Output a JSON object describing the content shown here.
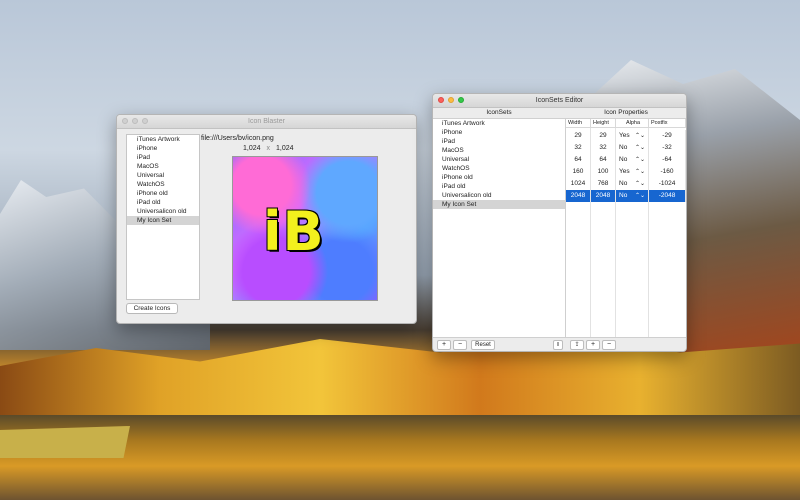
{
  "icon_blaster": {
    "title": "Icon Blaster",
    "list": [
      "iTunes Artwork",
      "iPhone",
      "iPad",
      "MacOS",
      "Universal",
      "WatchOS",
      "iPhone old",
      "iPad old",
      "Universalicon old",
      "My Icon Set"
    ],
    "selected_index": 9,
    "file_path": "file:///Users/bv/icon.png",
    "width": "1,024",
    "times": "x",
    "height": "1,024",
    "preview_text": "iB",
    "create_button": "Create Icons"
  },
  "iconsets_editor": {
    "title": "IconSets Editor",
    "left_header": "IconSets",
    "right_header": "Icon Properties",
    "sets": [
      "iTunes Artwork",
      "iPhone",
      "iPad",
      "MacOS",
      "Universal",
      "WatchOS",
      "iPhone old",
      "iPad old",
      "Universalicon old",
      "My Icon Set"
    ],
    "selected_set_index": 9,
    "columns": [
      "Width",
      "Height",
      "Alpha",
      "Postfix"
    ],
    "rows": [
      {
        "width": "29",
        "height": "29",
        "alpha": "Yes",
        "postfix": "-29"
      },
      {
        "width": "32",
        "height": "32",
        "alpha": "No",
        "postfix": "-32"
      },
      {
        "width": "64",
        "height": "64",
        "alpha": "No",
        "postfix": "-64"
      },
      {
        "width": "160",
        "height": "100",
        "alpha": "Yes",
        "postfix": "-160"
      },
      {
        "width": "1024",
        "height": "768",
        "alpha": "No",
        "postfix": "-1024"
      },
      {
        "width": "2048",
        "height": "2048",
        "alpha": "No",
        "postfix": "-2048"
      }
    ],
    "selected_row_index": 5,
    "stepper_glyph": "⌃⌄",
    "buttons": {
      "add": "+",
      "remove": "−",
      "reset": "Reset",
      "share": "⇪",
      "add_row": "+",
      "remove_row": "−",
      "collapse": "‖"
    }
  }
}
